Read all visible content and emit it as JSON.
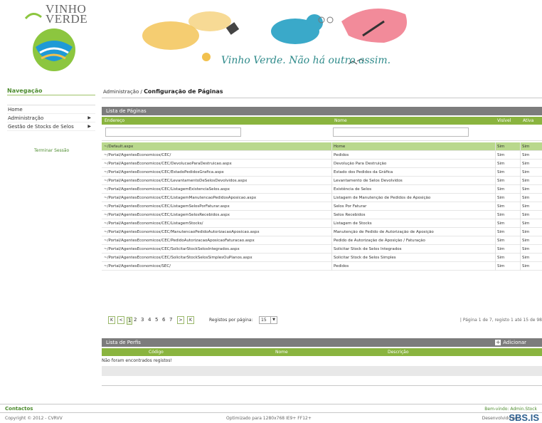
{
  "header": {
    "logo_line1": "VINHO",
    "logo_line2": "VERDE",
    "slogan": "Vinho Verde. Não há outro assim."
  },
  "nav": {
    "title": "Navegação",
    "items": [
      {
        "label": "Home",
        "has_arrow": false
      },
      {
        "label": "Administração",
        "has_arrow": true
      },
      {
        "label": "Gestão de Stocks de Selos",
        "has_arrow": true
      }
    ],
    "logout": "Terminar Sessão"
  },
  "breadcrumb": {
    "parent": "Administração",
    "separator": "/",
    "current": "Configuração de Páginas"
  },
  "pages_panel": {
    "title": "Lista de Páginas",
    "columns": [
      "Endereço",
      "Nome",
      "Visível",
      "Ativa"
    ],
    "rows": [
      [
        "~/Default.aspx",
        "Home",
        "Sim",
        "Sim"
      ],
      [
        "~/Portal/AgentesEconomicos/CEC/",
        "Pedidos",
        "Sim",
        "Sim"
      ],
      [
        "~/Portal/AgentesEconomicos/CEC/DevolucaoParaDestruicao.aspx",
        "Devolução Para Destruição",
        "Sim",
        "Sim"
      ],
      [
        "~/Portal/AgentesEconomicos/CEC/EstadoPedidosGrafica.aspx",
        "Estado dos Pedidos da Gráfica",
        "Sim",
        "Sim"
      ],
      [
        "~/Portal/AgentesEconomicos/CEC/LevantamentoDeSelosDevolvidos.aspx",
        "Levantamento de Selos Devolvidos",
        "Sim",
        "Sim"
      ],
      [
        "~/Portal/AgentesEconomicos/CEC/ListagemExistenciaSelos.aspx",
        "Existência de Selos",
        "Sim",
        "Sim"
      ],
      [
        "~/Portal/AgentesEconomicos/CEC/ListagemManutencaoPedidosAposicao.aspx",
        "Listagem de Manutenção de Pedidos de Aposição",
        "Sim",
        "Sim"
      ],
      [
        "~/Portal/AgentesEconomicos/CEC/ListagemSelosPorFaturar.aspx",
        "Selos Por Faturar",
        "Sim",
        "Sim"
      ],
      [
        "~/Portal/AgentesEconomicos/CEC/ListagemSelosRecebidos.aspx",
        "Selos Recebidos",
        "Sim",
        "Sim"
      ],
      [
        "~/Portal/AgentesEconomicos/CEC/ListagemStocks/",
        "Listagem de Stocks",
        "Sim",
        "Sim"
      ],
      [
        "~/Portal/AgentesEconomicos/CEC/ManutencaoPedidoAutorizacaoAposicao.aspx",
        "Manutenção de Pedido de Autorização de Aposição",
        "Sim",
        "Sim"
      ],
      [
        "~/Portal/AgentesEconomicos/CEC/PedidoAutorizacaoAposicaoFaturacao.aspx",
        "Pedido de Autorização de Aposição / Faturação",
        "Sim",
        "Sim"
      ],
      [
        "~/Portal/AgentesEconomicos/CEC/SolicitarStockSelosIntegrados.aspx",
        "Solicitar Stock de Selos Integrados",
        "Sim",
        "Sim"
      ],
      [
        "~/Portal/AgentesEconomicos/CEC/SolicitarStockSelosSimplesOuPlanos.aspx",
        "Solicitar Stock de Selos Simples",
        "Sim",
        "Sim"
      ],
      [
        "~/Portal/AgentesEconomicos/SEC/",
        "Pedidos",
        "Sim",
        "Sim"
      ]
    ],
    "pager": {
      "first": "K",
      "prev": "<",
      "pages": [
        "1",
        "2",
        "3",
        "4",
        "5",
        "6",
        "7"
      ],
      "next": ">",
      "last": "K",
      "rows_per_page_label": "Registos por página:",
      "rows_per_page_value": "15",
      "info": "| Página 1 de 7, registo 1 até 15 de 98"
    }
  },
  "profiles_panel": {
    "title": "Lista de Perfis",
    "add_label": "Adicionar",
    "columns": [
      "Código",
      "Nome",
      "Descrição"
    ],
    "empty_text": "Não foram encontrados registos!"
  },
  "footer": {
    "contacts": "Contactos",
    "welcome": "Bem-vindo: Admin.Stock",
    "copyright": "Copyright © 2012 - CVRVV",
    "optimized": "Optimizado para 1280x768 IE9+ FF12+",
    "developed_by": "Desenvolvido por",
    "developer": "SBS.IS"
  },
  "colors": {
    "brand_green": "#4d8c2e",
    "header_green": "#8ab43f",
    "selected_row": "#b9d88d",
    "panel_grey": "#7c7c7c"
  }
}
